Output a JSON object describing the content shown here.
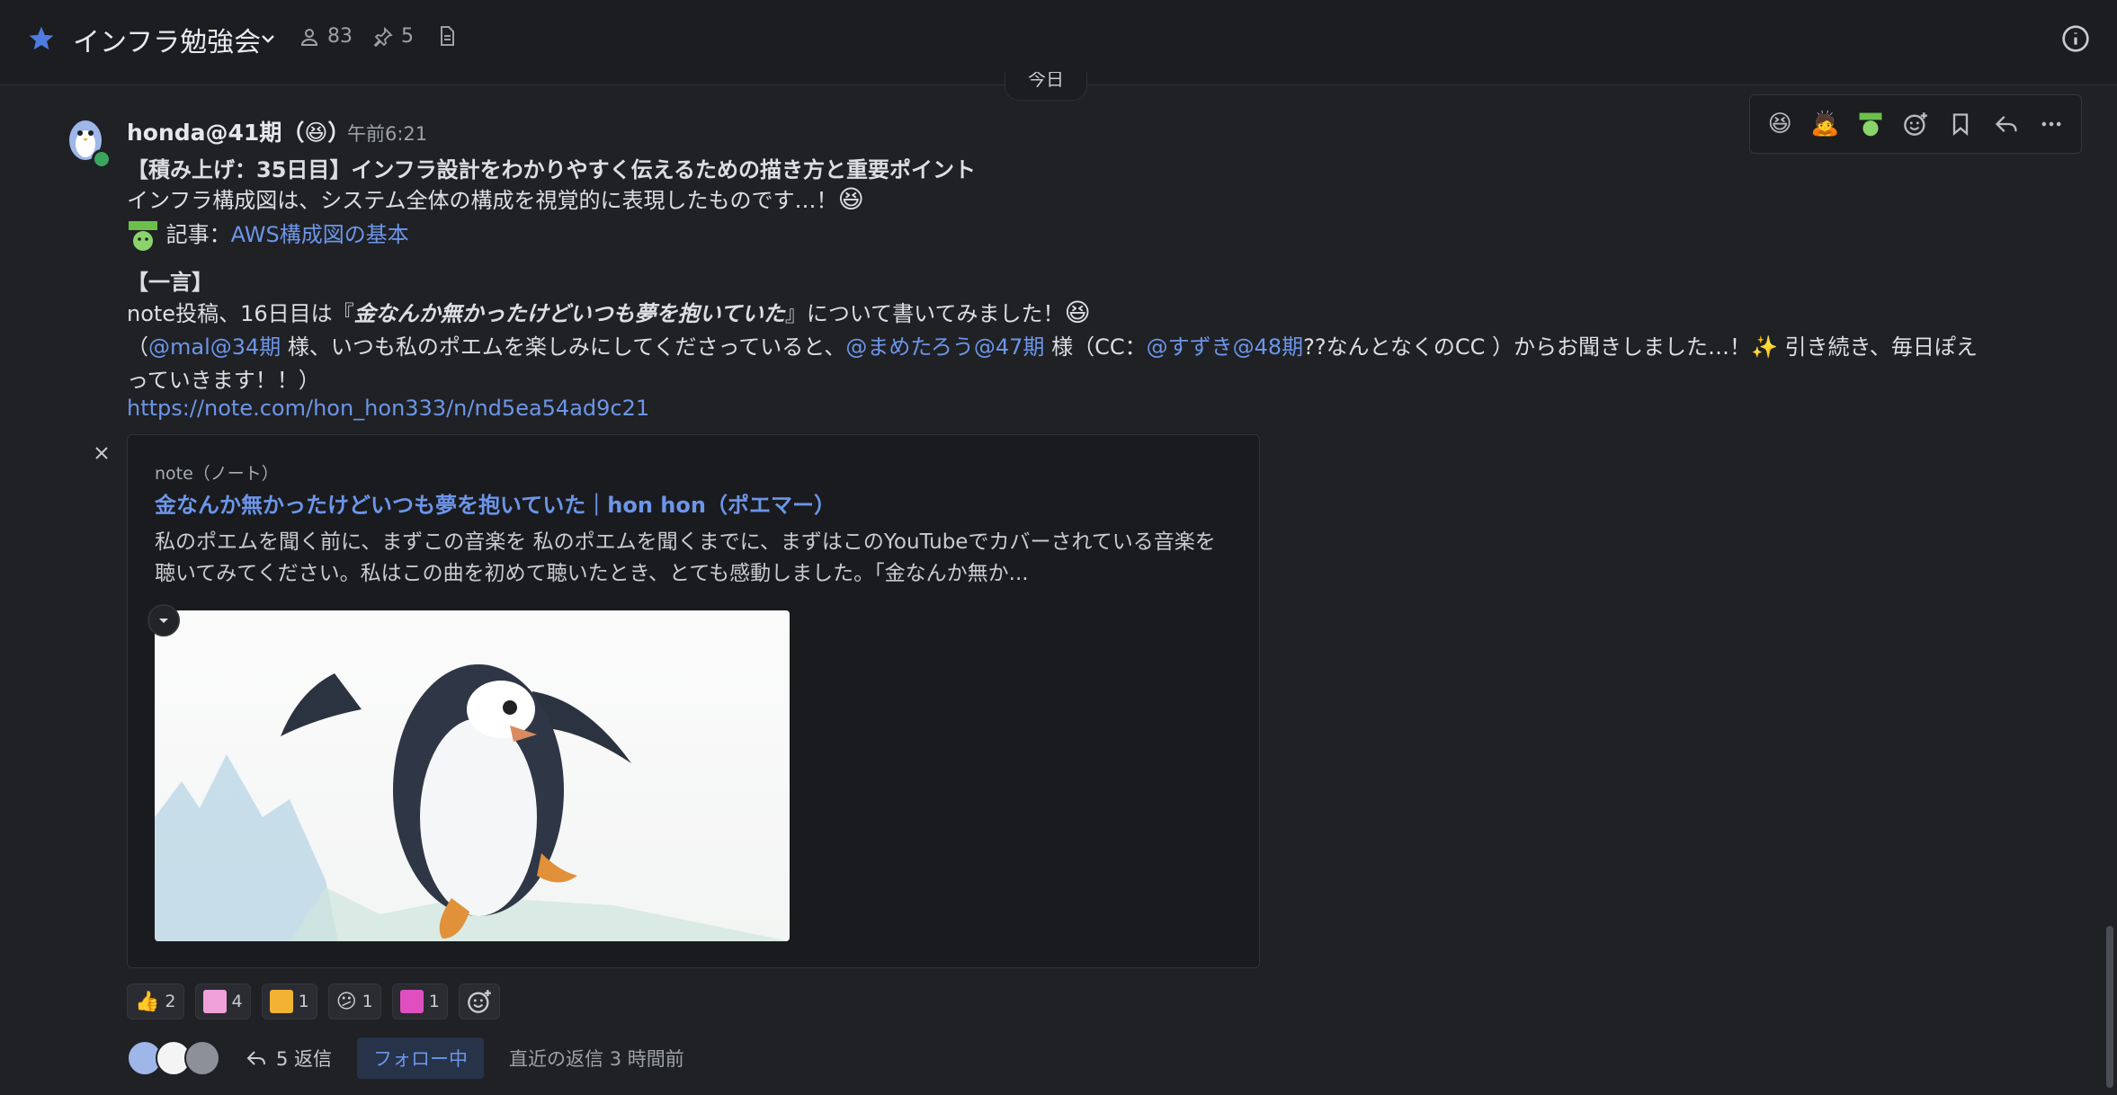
{
  "header": {
    "channel_name": "インフラ勉強会",
    "members_count": "83",
    "pinned_count": "5"
  },
  "date_divider": "今日",
  "toolbar": {
    "reaction_1": "😆",
    "reaction_2": "🙇"
  },
  "message": {
    "author": "honda@41期（😆）",
    "time": "午前6:21",
    "line1": "【積み上げ：35日目】インフラ設計をわかりやすく伝えるための描き方と重要ポイント",
    "line2": "インフラ構成図は、システム全体の構成を視覚的に表現したものです…！",
    "line2_emoji": "😆",
    "line3_prefix": "記事：",
    "line3_link": "AWS構成図の基本",
    "line4": "【一言】",
    "line5_prefix": "note投稿、16日目は『",
    "line5_emphasis": "金なんか無かったけどいつも夢を抱いていた",
    "line5_suffix": "』について書いてみました！",
    "line5_emoji": "😆",
    "line6_open": "（",
    "mention_1": "@mal@34期",
    "line6_mid1": " 様、いつも私のポエムを楽しみにしてくださっていると、",
    "mention_2": "@まめたろう@47期",
    "line6_mid2": " 様（CC：",
    "mention_3": "@すずき@48期",
    "line6_mid3": "??なんとなくのCC ）からお聞きしました…！✨ 引き続き、毎日ぽえ",
    "line7": "っていきます！！）",
    "url": "https://note.com/hon_hon333/n/nd5ea54ad9c21"
  },
  "embed": {
    "site": "note（ノート）",
    "title": "金なんか無かったけどいつも夢を抱いていた｜hon hon（ポエマー）",
    "description": "私のポエムを聞く前に、まずこの音楽を 私のポエムを聞くまでに、まずはこのYouTubeでカバーされている音楽を聴いてみてください。私はこの曲を初めて聴いたとき、とても感動しました。「金なんか無か..."
  },
  "reactions": [
    {
      "emoji": "👍",
      "count": "2"
    },
    {
      "emoji": "",
      "count": "4"
    },
    {
      "emoji": "",
      "count": "1"
    },
    {
      "emoji": "😕",
      "count": "1"
    },
    {
      "emoji": "",
      "count": "1"
    }
  ],
  "thread": {
    "reply_label": "5 返信",
    "follow_label": "フォロー中",
    "last_reply": "直近の返信 3 時間前"
  },
  "colors": {
    "background": "#1f2125",
    "accent": "#6d95e8",
    "online": "#3ba55d"
  }
}
